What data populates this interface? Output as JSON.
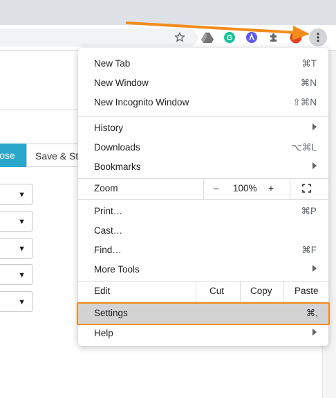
{
  "toolbar": {
    "icons": [
      "bookmark-star-icon",
      "google-drive-icon",
      "grammarly-icon",
      "extension-blue-icon",
      "extensions-puzzle-icon",
      "profile-icon",
      "more-menu-icon"
    ],
    "colors": {
      "accent_arrow": "#f28c1c",
      "grammarly": "#15c39a",
      "blue_ext": "#5b5bf0",
      "profile": "#e8431f"
    }
  },
  "page": {
    "close_button": "lose",
    "save_button": "Save & St",
    "select_caret": "▼"
  },
  "menu": {
    "new_tab": {
      "label": "New Tab",
      "shortcut": "⌘T"
    },
    "new_window": {
      "label": "New Window",
      "shortcut": "⌘N"
    },
    "new_incognito": {
      "label": "New Incognito Window",
      "shortcut": "⇧⌘N"
    },
    "history": {
      "label": "History"
    },
    "downloads": {
      "label": "Downloads",
      "shortcut": "⌥⌘L"
    },
    "bookmarks": {
      "label": "Bookmarks"
    },
    "zoom": {
      "label": "Zoom",
      "minus": "–",
      "value": "100%",
      "plus": "+"
    },
    "print": {
      "label": "Print…",
      "shortcut": "⌘P"
    },
    "cast": {
      "label": "Cast…"
    },
    "find": {
      "label": "Find…",
      "shortcut": "⌘F"
    },
    "more_tools": {
      "label": "More Tools"
    },
    "edit": {
      "label": "Edit",
      "cut": "Cut",
      "copy": "Copy",
      "paste": "Paste"
    },
    "settings": {
      "label": "Settings",
      "shortcut": "⌘,"
    },
    "help": {
      "label": "Help"
    }
  }
}
